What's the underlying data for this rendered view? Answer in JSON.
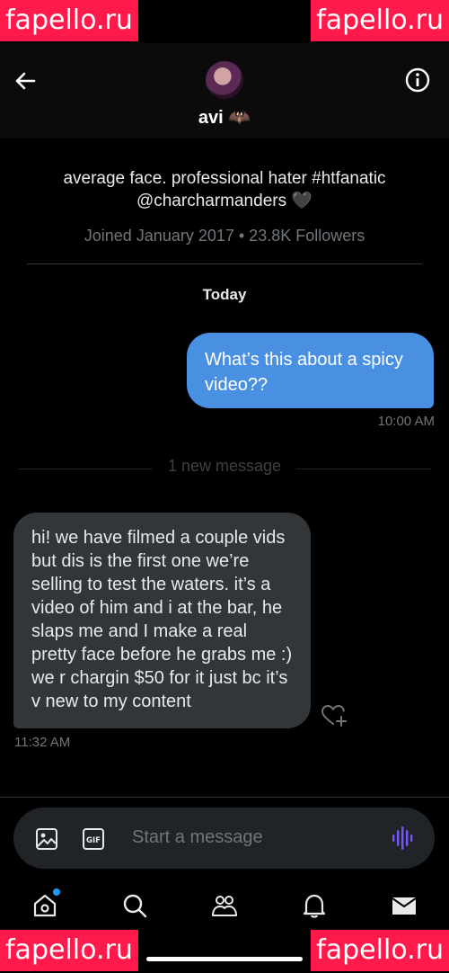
{
  "watermarks": [
    "fapello.ru",
    "fapello.ru",
    "fapello.ru",
    "fapello.ru"
  ],
  "header": {
    "name": "avi 🦇"
  },
  "profile": {
    "bio_line1": "average face. professional hater #htfanatic",
    "bio_line2": "@charcharmanders 🖤",
    "meta": "Joined January 2017 • 23.8K Followers"
  },
  "conversation": {
    "day_label": "Today",
    "outgoing": {
      "text": "What’s this about a spicy video??",
      "time": "10:00 AM"
    },
    "divider": "1 new message",
    "incoming": {
      "text": "hi! we have filmed a couple vids but dis is the first one we’re selling to test the waters. it’s a video of him and i at the bar, he slaps me and I make a real pretty face before he grabs me :) we r chargin $50 for it just bc it’s v new to my content",
      "time": "11:32 AM"
    }
  },
  "composer": {
    "placeholder": "Start a message",
    "icons": [
      "image-icon",
      "gif-icon",
      "voice-message-icon"
    ]
  },
  "tabbar": {
    "icons": [
      "home-icon",
      "search-icon",
      "communities-icon",
      "notifications-icon",
      "messages-icon"
    ]
  },
  "colors": {
    "accent": "#1d9bf0",
    "outgoing_bubble": "#4a90e2",
    "incoming_bubble": "#333639",
    "voice_icon": "#7856ff",
    "watermark": "#ff1a4b"
  }
}
